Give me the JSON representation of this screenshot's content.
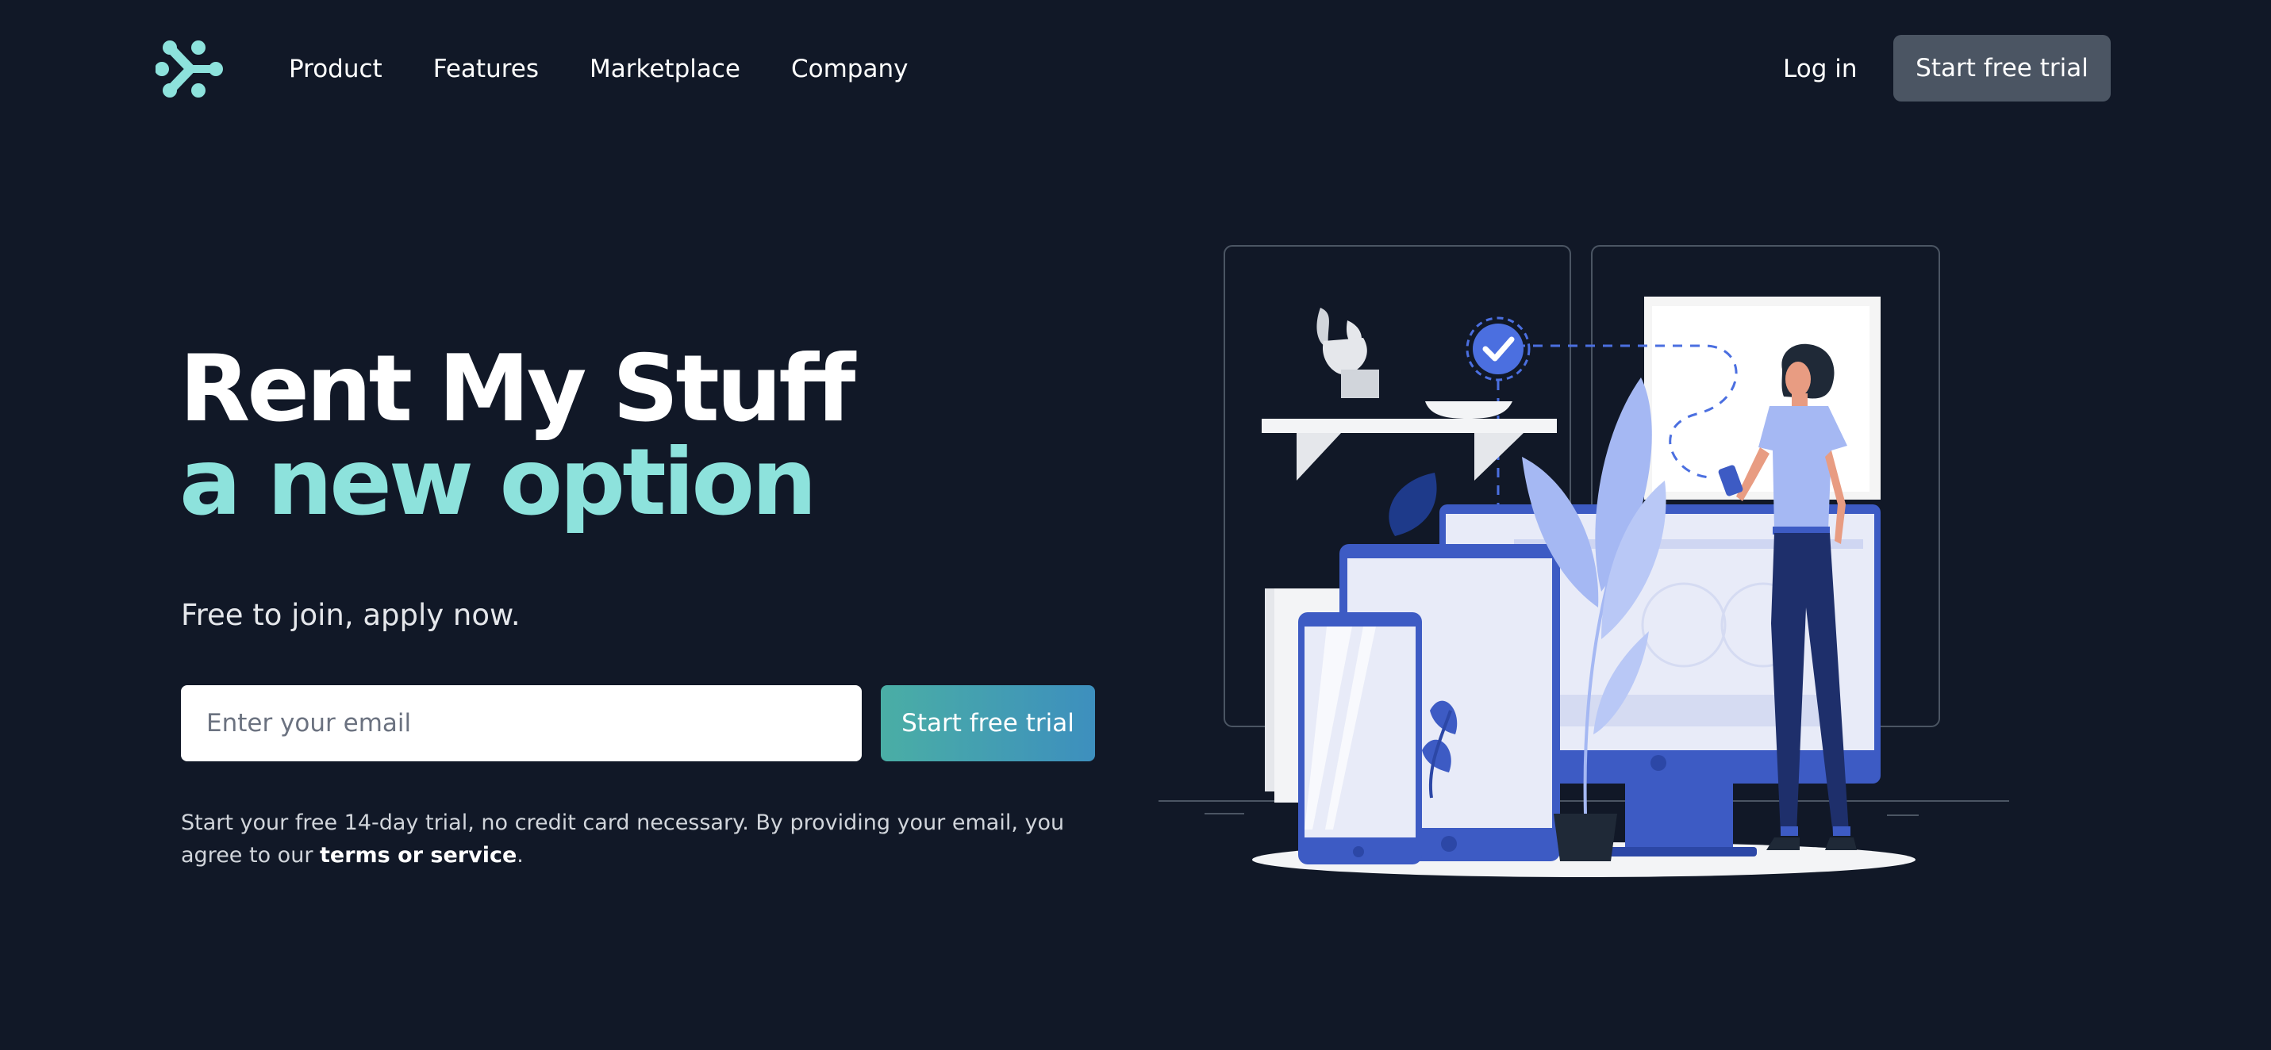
{
  "nav": {
    "logo_icon": "brand-logo-icon",
    "links": [
      {
        "label": "Product"
      },
      {
        "label": "Features"
      },
      {
        "label": "Marketplace"
      },
      {
        "label": "Company"
      }
    ],
    "login_label": "Log in",
    "cta_label": "Start free trial"
  },
  "hero": {
    "title_line1": "Rent My Stuff",
    "title_line2": "a new option",
    "subtitle": "Free to join, apply now.",
    "email_placeholder": "Enter your email",
    "cta_label": "Start free trial",
    "fine_print_before": "Start your free 14-day trial, no credit card necessary. By providing your email, you agree to our ",
    "terms_label": "terms or service",
    "fine_print_after": "."
  },
  "illustration": {
    "icon": "devices-with-woman-illustration",
    "check_icon": "checkmark-badge-icon"
  },
  "colors": {
    "background": "#111827",
    "accent_teal": "#8de2dc",
    "nav_button": "#4b5563",
    "cta_gradient_start": "#4aaea5",
    "cta_gradient_end": "#3d8fbe",
    "illustration_blue": "#3d5bc4"
  }
}
